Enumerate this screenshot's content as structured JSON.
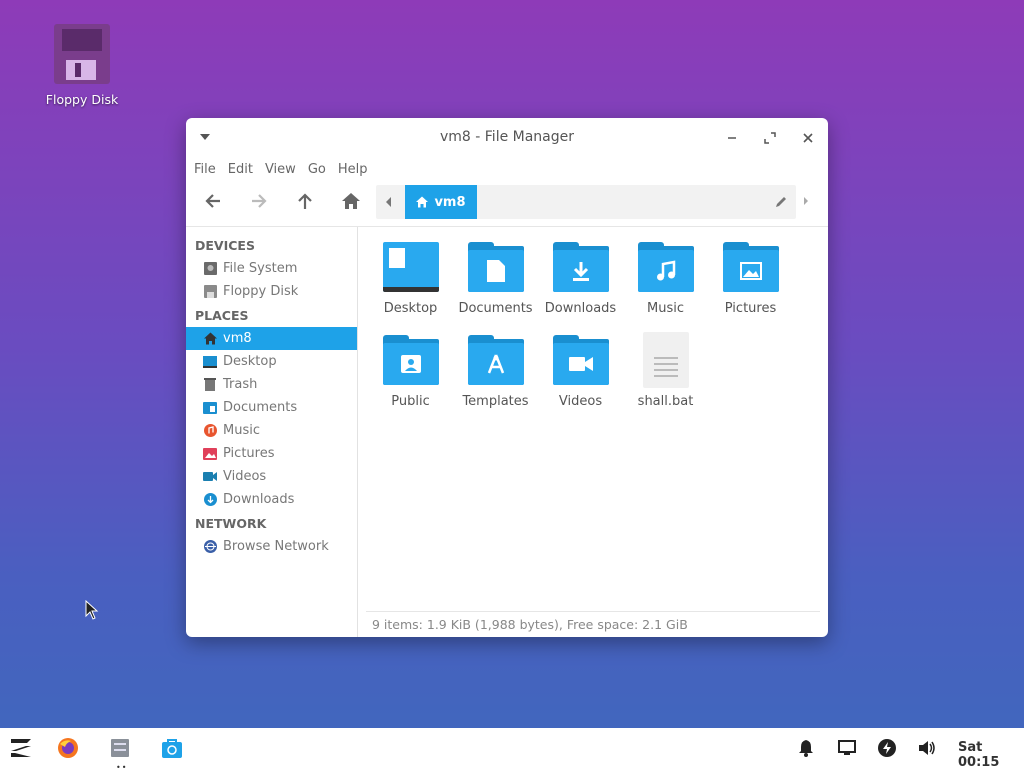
{
  "desktop": {
    "icons": [
      {
        "label": "Floppy Disk",
        "icon": "floppy-disk-icon"
      }
    ]
  },
  "window": {
    "title": "vm8 - File Manager",
    "menu": [
      "File",
      "Edit",
      "View",
      "Go",
      "Help"
    ],
    "path": {
      "crumb": "vm8"
    },
    "sidebar": {
      "devices_header": "DEVICES",
      "devices": [
        "File System",
        "Floppy Disk"
      ],
      "places_header": "PLACES",
      "places": [
        "vm8",
        "Desktop",
        "Trash",
        "Documents",
        "Music",
        "Pictures",
        "Videos",
        "Downloads"
      ],
      "network_header": "NETWORK",
      "network": [
        "Browse Network"
      ]
    },
    "files": [
      "Desktop",
      "Documents",
      "Downloads",
      "Music",
      "Pictures",
      "Public",
      "Templates",
      "Videos",
      "shall.bat"
    ],
    "status": "9 items: 1.9 KiB (1,988 bytes), Free space: 2.1 GiB"
  },
  "taskbar": {
    "clock": "Sat 00:15"
  },
  "colors": {
    "accent": "#1ea2e8",
    "folder": "#29a9ef"
  }
}
